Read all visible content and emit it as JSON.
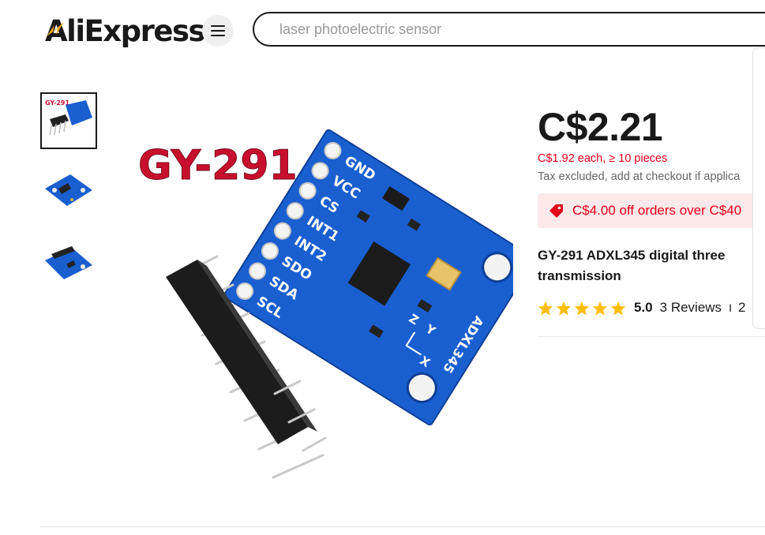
{
  "header": {
    "logo_text": "AliExpress",
    "search_placeholder": "laser photoelectric sensor"
  },
  "gallery": {
    "thumbnails": [
      {
        "label": "GY-291",
        "active": true
      },
      {
        "label": "",
        "active": false
      },
      {
        "label": "",
        "active": false
      }
    ],
    "main_image": {
      "title_text": "GY-291",
      "pin_labels": [
        "GND",
        "VCC",
        "CS",
        "INT1",
        "INT2",
        "SDO",
        "SDA",
        "SCL"
      ],
      "board_label": "ADXL345",
      "axis_labels": [
        "Y",
        "Z",
        "X"
      ],
      "board_color": "#1a5fd0",
      "title_color": "#c8102e"
    }
  },
  "product": {
    "price": "C$2.21",
    "bulk_price": "C$1.92 each, ≥ 10 pieces",
    "tax_note": "Tax excluded, add at checkout if applica",
    "coupon": "C$4.00 off orders over C$40",
    "title": "GY-291 ADXL345 digital three transmission",
    "rating": "5.0",
    "reviews": "3 Reviews",
    "separator": "I",
    "sold": "2",
    "star_count": 5,
    "star_color": "#ffbd00",
    "accent_color": "#e4001b"
  }
}
